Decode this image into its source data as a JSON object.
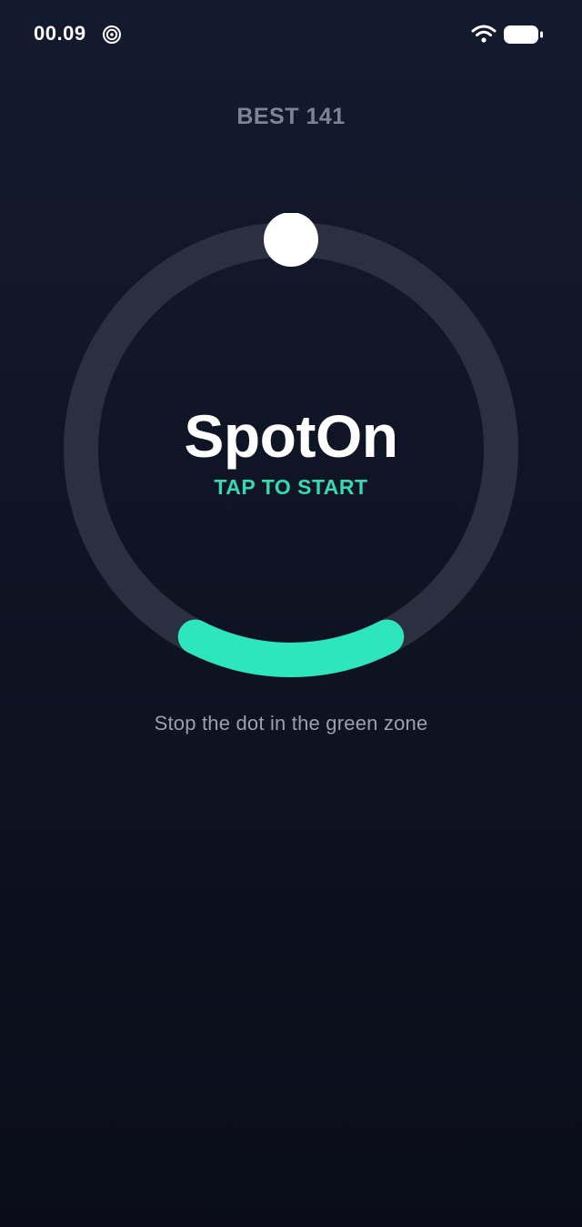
{
  "status_bar": {
    "time": "00.09",
    "app_icon": "spiral-icon",
    "wifi_icon": "wifi-icon",
    "battery_icon": "battery-icon"
  },
  "game": {
    "best_score": "BEST 141",
    "title": "SpotOn",
    "start_prompt": "TAP TO START",
    "instruction": "Stop the dot in the green zone"
  },
  "colors": {
    "background": "#10152a",
    "track": "#2b3040",
    "target_zone": "#2ee6bd",
    "dot": "#ffffff",
    "accent_text": "#36d9b1"
  }
}
